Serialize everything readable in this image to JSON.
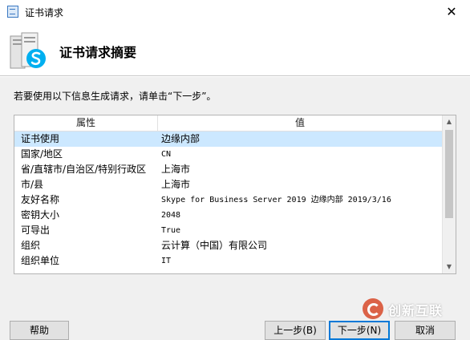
{
  "window": {
    "title": "证书请求",
    "close_glyph": "✕"
  },
  "header": {
    "heading": "证书请求摘要",
    "icon": "skype-server-icon"
  },
  "instruction": "若要使用以下信息生成请求，请单击“下一步”。",
  "table": {
    "columns": [
      "属性",
      "值"
    ],
    "rows": [
      {
        "key": "证书使用",
        "value": "边缘内部"
      },
      {
        "key": "国家/地区",
        "value": "CN"
      },
      {
        "key": "省/直辖市/自治区/特别行政区",
        "value": "上海市"
      },
      {
        "key": "市/县",
        "value": "上海市"
      },
      {
        "key": "友好名称",
        "value": "Skype for Business Server 2019 边缘内部 2019/3/16"
      },
      {
        "key": "密钥大小",
        "value": "2048"
      },
      {
        "key": "可导出",
        "value": "True"
      },
      {
        "key": "组织",
        "value": "云计算（中国）有限公司"
      },
      {
        "key": "组织单位",
        "value": "IT"
      }
    ],
    "selected_index": 0
  },
  "scrollbar": {
    "up_glyph": "▲",
    "down_glyph": "▼"
  },
  "buttons": {
    "help": "帮助",
    "prev": "上一步(B)",
    "next": "下一步(N)",
    "cancel": "取消"
  },
  "watermark": {
    "text": "创新互联"
  },
  "colors": {
    "selection": "#cce8ff",
    "accent": "#0078d7",
    "skype": "#00aff0"
  }
}
